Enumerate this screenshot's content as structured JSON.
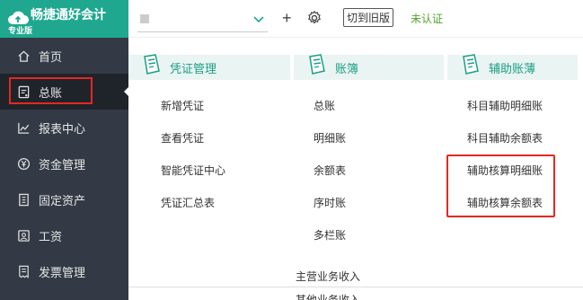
{
  "app": {
    "brand_name": "畅捷通好会计",
    "edition": "专业版"
  },
  "sidebar": {
    "items": [
      {
        "label": "首页",
        "icon": "home-icon"
      },
      {
        "label": "总账",
        "icon": "ledger-icon",
        "active": true
      },
      {
        "label": "报表中心",
        "icon": "chart-icon"
      },
      {
        "label": "资金管理",
        "icon": "yen-icon"
      },
      {
        "label": "固定资产",
        "icon": "asset-icon"
      },
      {
        "label": "工资",
        "icon": "salary-icon"
      },
      {
        "label": "发票管理",
        "icon": "invoice-icon"
      }
    ]
  },
  "topbar": {
    "switch_old_label": "切到旧版",
    "cert_status": "未认证"
  },
  "menu": {
    "columns": [
      {
        "title": "凭证管理",
        "items": [
          "新增凭证",
          "查看凭证",
          "智能凭证中心",
          "凭证汇总表"
        ]
      },
      {
        "title": "账簿",
        "items": [
          "总账",
          "明细账",
          "余额表",
          "序时账",
          "多栏账"
        ]
      },
      {
        "title": "辅助账薄",
        "items": [
          "科目辅助明细账",
          "科目辅助余额表",
          "辅助核算明细账",
          "辅助核算余额表"
        ]
      }
    ]
  },
  "background": {
    "row1": "主营业务收入",
    "row2": "其他业务收入"
  },
  "colors": {
    "brand": "#1fa88f",
    "sidebar": "#333a45",
    "highlight": "#e5281f",
    "accent_text": "#1a9f86",
    "cert_status": "#52a22c"
  }
}
